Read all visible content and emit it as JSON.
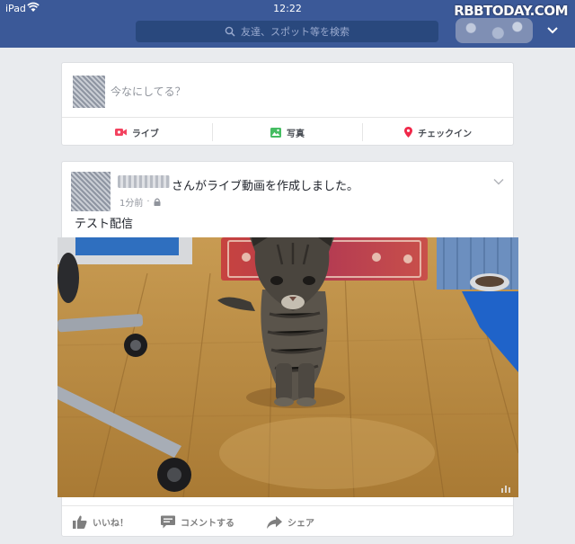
{
  "status_bar": {
    "device": "iPad",
    "time": "12:22",
    "watermark": "RBBTODAY.COM"
  },
  "header": {
    "search_placeholder": "友達、スポット等を検索"
  },
  "composer": {
    "prompt": "今なにしてる？",
    "actions": [
      {
        "label": "ライブ",
        "icon": "live-video-icon",
        "color": "#f3425f"
      },
      {
        "label": "写真",
        "icon": "photo-icon",
        "color": "#45bd62"
      },
      {
        "label": "チェックイン",
        "icon": "location-pin-icon",
        "color": "#f02849"
      }
    ]
  },
  "post": {
    "headline": "さんがライブ動画を作成しました。",
    "time": "1分前",
    "privacy_icon": "lock-icon",
    "caption": "テスト配信",
    "video_thumbnail": "cat-on-wooden-floor",
    "actions": [
      {
        "label": "いいね！",
        "icon": "like-icon"
      },
      {
        "label": "コメントする",
        "icon": "comment-icon"
      },
      {
        "label": "シェア",
        "icon": "share-icon"
      }
    ]
  },
  "colors": {
    "brand": "#3b5998",
    "background": "#e9ebee"
  }
}
